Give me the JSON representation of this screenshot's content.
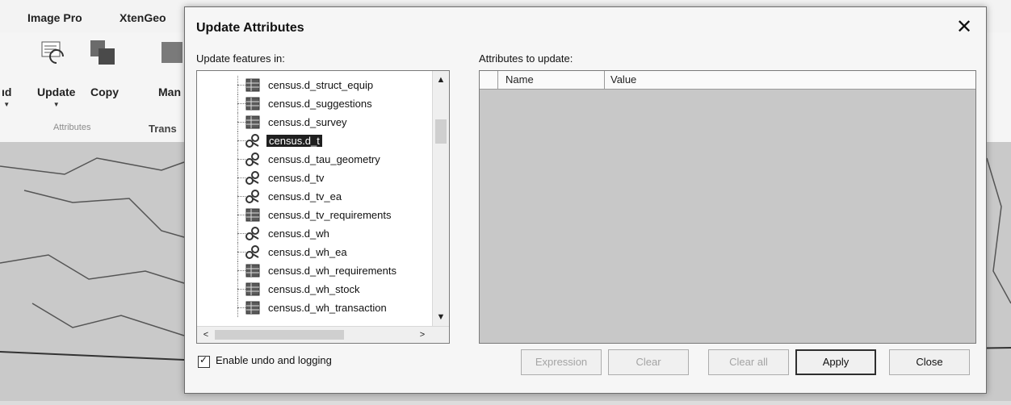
{
  "ribbon": {
    "tabs": [
      "Image Pro",
      "XtenGeo"
    ],
    "buttons": [
      {
        "label": "ıd"
      },
      {
        "label": "Update"
      },
      {
        "label": "Copy"
      },
      {
        "label": "Man"
      }
    ],
    "groups": [
      "Attributes",
      "Trans"
    ]
  },
  "dialog": {
    "title": "Update Attributes",
    "close_glyph": "✕",
    "left_label": "Update features in:",
    "right_label": "Attributes to update:",
    "tree_items": [
      {
        "label": "census.d_struct_equip",
        "icon": "table-icon"
      },
      {
        "label": "census.d_suggestions",
        "icon": "table-icon"
      },
      {
        "label": "census.d_survey",
        "icon": "table-icon"
      },
      {
        "label": "census.d_t",
        "icon": "geometry-layer-icon",
        "selected": true
      },
      {
        "label": "census.d_tau_geometry",
        "icon": "geometry-layer-icon"
      },
      {
        "label": "census.d_tv",
        "icon": "geometry-layer-icon"
      },
      {
        "label": "census.d_tv_ea",
        "icon": "geometry-layer-icon"
      },
      {
        "label": "census.d_tv_requirements",
        "icon": "table-icon"
      },
      {
        "label": "census.d_wh",
        "icon": "geometry-layer-icon"
      },
      {
        "label": "census.d_wh_ea",
        "icon": "geometry-layer-icon"
      },
      {
        "label": "census.d_wh_requirements",
        "icon": "table-icon"
      },
      {
        "label": "census.d_wh_stock",
        "icon": "table-icon"
      },
      {
        "label": "census.d_wh_transaction",
        "icon": "table-icon"
      }
    ],
    "grid_columns": [
      "Name",
      "Value"
    ],
    "checkbox_label": "Enable undo and logging",
    "checkbox_checked": true,
    "buttons": {
      "expression": "Expression",
      "clear": "Clear",
      "clear_all": "Clear all",
      "apply": "Apply",
      "close": "Close"
    },
    "scroll_glyphs": {
      "up": "▲",
      "down": "▼",
      "left": "<",
      "right": ">"
    }
  }
}
